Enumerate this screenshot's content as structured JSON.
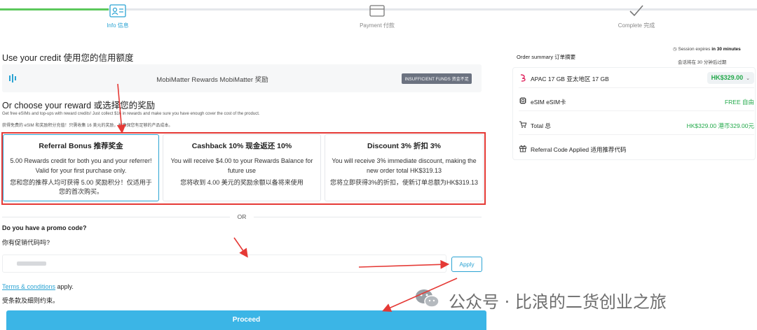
{
  "stepper": {
    "steps": [
      {
        "label": "Info 信息",
        "state": "active"
      },
      {
        "label": "Payment 付款",
        "state": "inactive"
      },
      {
        "label": "Complete 完成",
        "state": "inactive"
      }
    ]
  },
  "credit": {
    "heading": "Use your credit 使用您的信用额度",
    "provider_name": "MobiMatter Rewards MobiMatter 奖励",
    "badge": "INSUFFICIENT FUNDS 资金不足"
  },
  "reward": {
    "heading": "Or choose your reward 或选择您的奖励",
    "desc_en": "Get free eSIMs and top-ups with reward credits! Just collect $16 in rewards and make sure you have enough cover the cost of the product.",
    "desc_zh": "获得免费的 eSIM 和奖励积分充值！只需收集 16 美元的奖励，并确保您有足够的产品成本。",
    "options": [
      {
        "title": "Referral Bonus 推荐奖金",
        "desc": "5.00 Rewards credit for both you and your referrer! Valid for your first purchase only.",
        "desc_zh": "您和您的推荐人均可获得 5.00 奖励积分！仅适用于您的首次购买。",
        "selected": true
      },
      {
        "title": "Cashback 10% 现金返还 10%",
        "desc": "You will receive $4.00 to your Rewards Balance for future use",
        "desc_zh": "您将收到 4.00 美元的奖励余额以备将来使用",
        "selected": false
      },
      {
        "title": "Discount 3% 折扣 3%",
        "desc": "You will receive 3% immediate discount, making the new order total HK$319.13",
        "desc_zh": "您将立即获得3%的折扣，使新订单总额为HK$319.13",
        "selected": false
      }
    ]
  },
  "divider": {
    "or_label": "OR"
  },
  "promo": {
    "question": "Do you have a promo code?",
    "question_zh": "你有促销代码吗?",
    "input_value": "",
    "apply_label": "Apply"
  },
  "terms": {
    "link_label": "Terms & conditions",
    "suffix": " apply.",
    "zh": "受条款及细则约束。"
  },
  "proceed_label": "Proceed",
  "summary": {
    "title": "Order summary 订单摘要",
    "session_prefix": "Session expires ",
    "session_time": "in 30 minutes",
    "session_zh": "会话将在 30 分钟后过期",
    "plan_label": "APAC 17 GB 亚太地区 17 GB",
    "plan_price": "HK$329.00",
    "esim_label": "eSIM eSIM卡",
    "esim_value": "FREE 自由",
    "total_label": "Total 总",
    "total_value": "HK$329.00 港币329.00元",
    "referral_label": "Referral Code Applied 适用推荐代码"
  },
  "watermark": "公众号 · 比浪的二货创业之旅",
  "colors": {
    "accent": "#2ba3d3",
    "proceed": "#3bb5e6",
    "success": "#22a94a",
    "progress": "#5cc85c",
    "annotation": "#e53935"
  }
}
